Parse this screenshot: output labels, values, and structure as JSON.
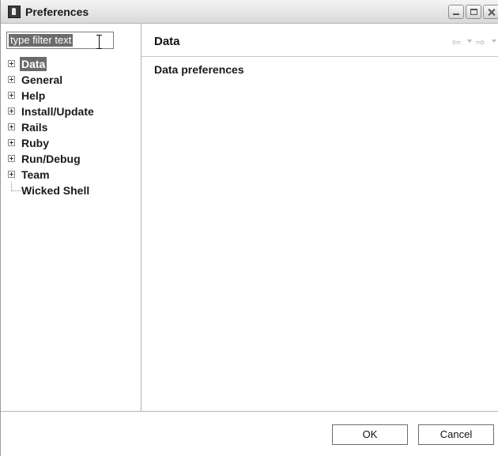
{
  "window": {
    "title": "Preferences",
    "icons": [
      "app-icon",
      "minimize-icon",
      "maximize-icon",
      "close-icon"
    ]
  },
  "filter": {
    "value": "type filter text"
  },
  "tree": {
    "items": [
      {
        "label": "Data",
        "expandable": true,
        "selected": true
      },
      {
        "label": "General",
        "expandable": true
      },
      {
        "label": "Help",
        "expandable": true
      },
      {
        "label": "Install/Update",
        "expandable": true
      },
      {
        "label": "Rails",
        "expandable": true
      },
      {
        "label": "Ruby",
        "expandable": true
      },
      {
        "label": "Run/Debug",
        "expandable": true
      },
      {
        "label": "Team",
        "expandable": true
      },
      {
        "label": "Wicked Shell",
        "expandable": false
      }
    ]
  },
  "page": {
    "title": "Data",
    "description": "Data preferences",
    "nav_icons": [
      "back-arrow-icon",
      "back-dropdown-icon",
      "forward-arrow-icon",
      "forward-dropdown-icon"
    ]
  },
  "buttons": {
    "ok": "OK",
    "cancel": "Cancel"
  },
  "colors": {
    "selection": "#6b6b6b",
    "selection_text": "#ffffff"
  }
}
